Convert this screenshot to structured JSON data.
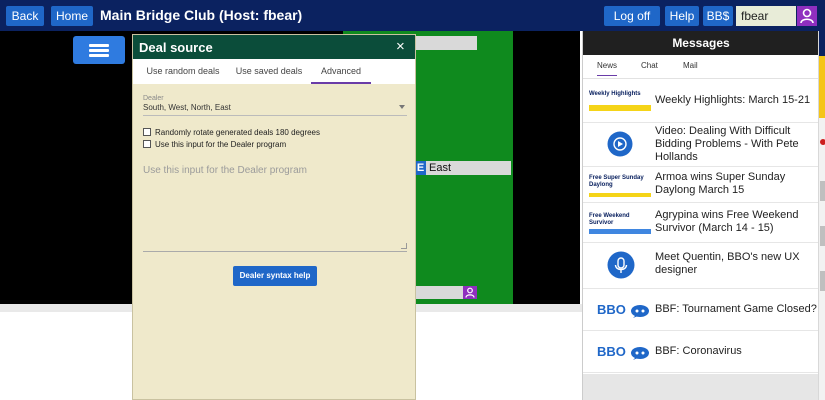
{
  "topbar": {
    "back_label": "Back",
    "home_label": "Home",
    "title": "Main Bridge Club (Host: fbear)",
    "logoff_label": "Log off",
    "help_label": "Help",
    "bbs_label": "BB$",
    "username": "fbear"
  },
  "table": {
    "east_seat": "E",
    "east_label": "East"
  },
  "dialog": {
    "title": "Deal source",
    "close_glyph": "×",
    "tabs": [
      {
        "label": "Use random deals"
      },
      {
        "label": "Use saved deals"
      },
      {
        "label": "Advanced"
      }
    ],
    "dealer_label": "Dealer",
    "dealer_value": "South, West, North, East",
    "checkbox_rotate_label": "Randomly rotate generated deals 180 degrees",
    "checkbox_input_label": "Use this input for the Dealer program",
    "textarea_placeholder": "Use this input for the Dealer program",
    "syntax_button_label": "Dealer syntax help"
  },
  "messages": {
    "title": "Messages",
    "tabs": [
      {
        "label": "News"
      },
      {
        "label": "Chat"
      },
      {
        "label": "Mail"
      }
    ],
    "news": [
      {
        "thumb_text": "Weekly Highlights",
        "text": "Weekly Highlights: March 15-21"
      },
      {
        "thumb_text": "",
        "text": "Video: Dealing With Difficult Bidding Problems - With Pete Hollands"
      },
      {
        "thumb_text": "Free Super Sunday Daylong",
        "text": "Armoa wins Super Sunday Daylong March 15"
      },
      {
        "thumb_text": "Free Weekend Survivor",
        "text": "Agrypina wins Free Weekend Survivor (March 14 - 15)"
      },
      {
        "thumb_text": "",
        "text": "Meet Quentin, BBO's new UX designer"
      },
      {
        "thumb_text": "BBO",
        "text": "BBF: Tournament Game Closed?"
      },
      {
        "thumb_text": "BBO",
        "text": "BBF: Coronavirus"
      }
    ]
  },
  "colors": {
    "topbar": "#0b2260",
    "button_blue": "#1f67c8",
    "dialog_header": "#0b4d3a",
    "felt": "#0f8a1e",
    "dialog_body": "#efe9cb",
    "accent_purple": "#8f2fbf"
  }
}
